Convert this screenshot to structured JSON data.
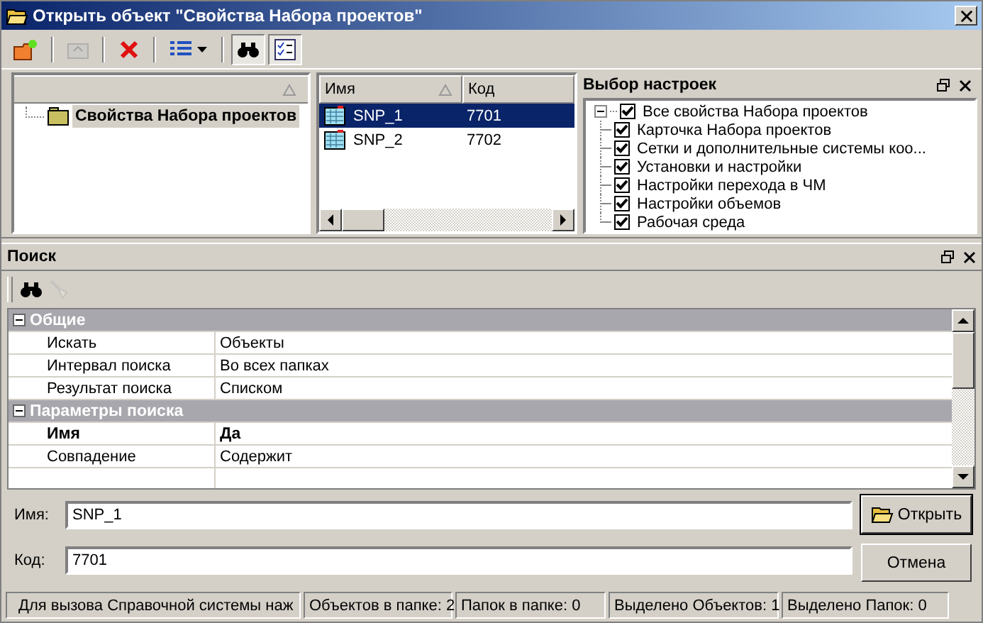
{
  "window": {
    "title": "Открыть объект \"Свойства Набора проектов\""
  },
  "toolbar": [
    {
      "kind": "new-folder",
      "pressed": false,
      "disabled": false
    },
    {
      "kind": "up-folder",
      "pressed": false,
      "disabled": true
    },
    {
      "kind": "delete",
      "pressed": false,
      "disabled": false
    },
    {
      "kind": "view-list",
      "pressed": false,
      "disabled": false
    },
    {
      "kind": "binoculars",
      "pressed": true,
      "disabled": false
    },
    {
      "kind": "checklist",
      "pressed": true,
      "disabled": false
    }
  ],
  "tree": {
    "items": [
      {
        "label": "Свойства Набора проектов",
        "selected": true
      }
    ]
  },
  "list": {
    "columns": [
      "Имя",
      "Код"
    ],
    "rows": [
      {
        "name": "SNP_1",
        "code": "7701",
        "selected": true
      },
      {
        "name": "SNP_2",
        "code": "7702",
        "selected": false
      }
    ]
  },
  "settings": {
    "title": "Выбор настроек",
    "root": {
      "label": "Все свойства Набора проектов",
      "checked": true,
      "expanded": true,
      "children": [
        {
          "label": "Карточка Набора проектов",
          "checked": true
        },
        {
          "label": "Сетки и дополнительные системы коо...",
          "checked": true
        },
        {
          "label": "Установки и настройки",
          "checked": true
        },
        {
          "label": "Настройки перехода в ЧМ",
          "checked": true
        },
        {
          "label": "Настройки объемов",
          "checked": true
        },
        {
          "label": "Рабочая среда",
          "checked": true
        }
      ]
    }
  },
  "search": {
    "title": "Поиск",
    "toolbar": [
      {
        "kind": "binoculars",
        "disabled": false
      },
      {
        "kind": "broom",
        "disabled": true
      }
    ],
    "groups": [
      {
        "title": "Общие",
        "expanded": true,
        "rows": [
          {
            "name": "Искать",
            "value": "Объекты",
            "bold": false
          },
          {
            "name": "Интервал поиска",
            "value": "Во всех папках",
            "bold": false
          },
          {
            "name": "Результат поиска",
            "value": "Списком",
            "bold": false
          }
        ]
      },
      {
        "title": "Параметры поиска",
        "expanded": true,
        "rows": [
          {
            "name": "Имя",
            "value": "Да",
            "bold": true
          },
          {
            "name": "Совпадение",
            "value": "Содержит",
            "bold": false
          }
        ]
      }
    ]
  },
  "form": {
    "fields": [
      {
        "label": "Имя:",
        "value": "SNP_1"
      },
      {
        "label": "Код:",
        "value": "7701"
      }
    ],
    "buttons": [
      {
        "label": "Открыть",
        "kind": "open",
        "default": true
      },
      {
        "label": "Отмена",
        "kind": "plain",
        "default": false
      }
    ]
  },
  "status_bar": [
    "Для вызова Справочной системы наж",
    "Объектов в папке: 2",
    "Папок в папке: 0",
    "Выделено Объектов: 1",
    "Выделено Папок: 0"
  ]
}
